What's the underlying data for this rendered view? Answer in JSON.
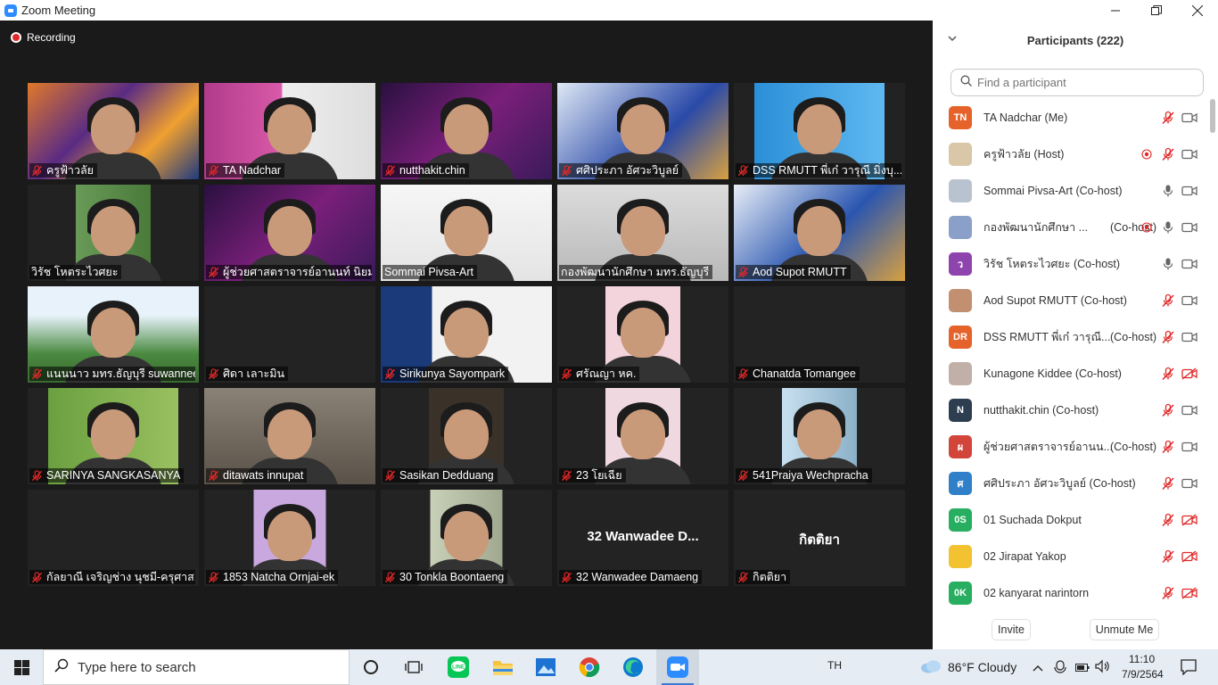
{
  "window": {
    "title": "Zoom Meeting",
    "minimize_icon": "minimize-icon",
    "restore_icon": "restore-icon",
    "close_icon": "close-icon"
  },
  "meeting": {
    "recording_label": "Recording",
    "tiles": [
      {
        "name": "ครูฟ้าวลัย",
        "muted": true
      },
      {
        "name": "TA Nadchar",
        "muted": true
      },
      {
        "name": "nutthakit.chin",
        "muted": true
      },
      {
        "name": "ศศิประภา อัศวะวิบูลย์",
        "muted": true
      },
      {
        "name": "DSS RMUTT พี่เก๋ วารุณี มิ่งบุ...",
        "muted": true
      },
      {
        "name": "วิรัช  โหตระไวศยะ",
        "muted": false
      },
      {
        "name": "ผู้ช่วยศาสตราจารย์อานนท์ นิยม...",
        "muted": true
      },
      {
        "name": "Sommai Pivsa-Art",
        "muted": false,
        "active": true
      },
      {
        "name": "กองพัฒนานักศึกษา มทร.ธัญบุรี",
        "muted": false
      },
      {
        "name": "Aod Supot RMUTT",
        "muted": true
      },
      {
        "name": "แนนนาว มทร.ธัญบุรี suwannee",
        "muted": true
      },
      {
        "name": "ศิดา เลาะมิน",
        "muted": true
      },
      {
        "name": "Sirikunya Sayompark",
        "muted": true
      },
      {
        "name": "ศรัณญา หค.",
        "muted": true
      },
      {
        "name": "Chanatda Tomangee",
        "muted": true
      },
      {
        "name": "SARINYA SANGKASANYA",
        "muted": true
      },
      {
        "name": "ditawats innupat",
        "muted": true
      },
      {
        "name": "Sasikan Dedduang",
        "muted": true
      },
      {
        "name": "23 โยเฉีย",
        "muted": true
      },
      {
        "name": "541Praiya Wechpracha",
        "muted": true
      },
      {
        "name": "กัลยาณี เจริญช่าง นุชมี-ครุศาส...",
        "muted": true
      },
      {
        "name": "1853 Natcha Ornjai-ek",
        "muted": true
      },
      {
        "name": "30 Tonkla Boontaeng",
        "muted": true
      },
      {
        "name": "32 Wanwadee Damaeng",
        "muted": true,
        "center_text": "32  Wanwadee  D..."
      },
      {
        "name": "กิตติยา",
        "muted": true,
        "center_text": "กิตติยา"
      }
    ]
  },
  "participants": {
    "title": "Participants (222)",
    "search_placeholder": "Find a participant",
    "items": [
      {
        "initials": "TN",
        "color": "#e5632b",
        "name": "TA Nadchar (Me)",
        "mic": "muted",
        "video": "on",
        "rec": false
      },
      {
        "initials": "",
        "color": "#d9c7a8",
        "name": "ครูฟ้าวลัย (Host)",
        "mic": "muted",
        "video": "on",
        "rec": true
      },
      {
        "initials": "",
        "color": "#b9c3d0",
        "name": "Sommai Pivsa-Art (Co-host)",
        "mic": "on",
        "video": "on",
        "rec": false
      },
      {
        "initials": "",
        "color": "#8aa0c8",
        "name": "กองพัฒนานักศึกษา ...",
        "suffix": "(Co-host)",
        "mic": "on",
        "video": "on",
        "rec": true
      },
      {
        "initials": "ว",
        "color": "#8e44ad",
        "name": "วิรัช  โหตระไวศยะ (Co-host)",
        "mic": "on",
        "video": "on",
        "rec": false
      },
      {
        "initials": "",
        "color": "#c29070",
        "name": "Aod Supot RMUTT (Co-host)",
        "mic": "muted",
        "video": "on",
        "rec": false
      },
      {
        "initials": "DR",
        "color": "#e5632b",
        "name": "DSS RMUTT พี่เก๋ วารุณี...",
        "suffix": "(Co-host)",
        "mic": "muted",
        "video": "on",
        "rec": false
      },
      {
        "initials": "",
        "color": "#c0b0a8",
        "name": "Kunagone Kiddee (Co-host)",
        "mic": "muted",
        "video": "off",
        "rec": false
      },
      {
        "initials": "N",
        "color": "#2c3e50",
        "name": "nutthakit.chin (Co-host)",
        "mic": "muted",
        "video": "on",
        "rec": false
      },
      {
        "initials": "ผ",
        "color": "#d1453b",
        "name": "ผู้ช่วยศาสตราจารย์อานน...",
        "suffix": "(Co-host)",
        "mic": "muted",
        "video": "on",
        "rec": false
      },
      {
        "initials": "ศ",
        "color": "#2f80c8",
        "name": "ศศิประภา อัศวะวิบูลย์ (Co-host)",
        "mic": "muted",
        "video": "on",
        "rec": false
      },
      {
        "initials": "0S",
        "color": "#27ae60",
        "name": "01 Suchada Dokput",
        "mic": "muted",
        "video": "off",
        "rec": false
      },
      {
        "initials": "",
        "color": "#f2c230",
        "name": "02 Jirapat Yakop",
        "mic": "muted",
        "video": "off",
        "rec": false
      },
      {
        "initials": "0K",
        "color": "#27ae60",
        "name": "02 kanyarat narintorn",
        "mic": "muted",
        "video": "off",
        "rec": false
      }
    ],
    "invite_label": "Invite",
    "unmute_label": "Unmute Me"
  },
  "taskbar": {
    "search_placeholder": "Type here to search",
    "lang": "TH",
    "weather": "86°F  Cloudy",
    "time": "11:10",
    "date": "7/9/2564",
    "apps": [
      "task-view-icon",
      "line-icon",
      "file-explorer-icon",
      "photos-icon",
      "chrome-icon",
      "edge-icon",
      "zoom-icon"
    ]
  },
  "colors": {
    "muted_red": "#e02828",
    "zoom_blue": "#2d8cff",
    "active_speaker": "#d8f040"
  }
}
